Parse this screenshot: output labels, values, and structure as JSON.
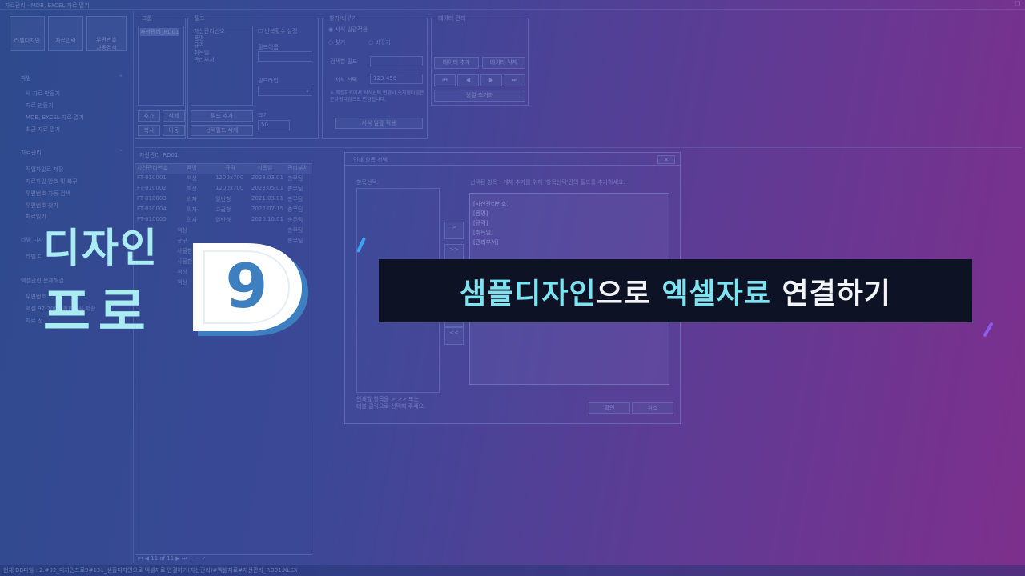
{
  "window": {
    "title": "자료관리 - MDB, EXCEL 자료 열기",
    "toolbar": [
      "라벨디자인",
      "자료입력",
      "우편번호\n자동검색"
    ]
  },
  "sidebar": {
    "sections": [
      {
        "title": "파일",
        "items": [
          "새 자료 만들기",
          "자료 만들기",
          "MDB, EXCEL 자료 열기",
          "최근 자료 열기"
        ]
      },
      {
        "title": "자료관리",
        "items": [
          "작업파일로 저장",
          "자료파일 암호 및 복구",
          "우편번호 자동 검색",
          "우편번호 찾기",
          "자료읽기"
        ]
      },
      {
        "title": "라벨 디자",
        "items": [
          "라벨 디"
        ]
      },
      {
        "title": "엑셀관련 문제해결",
        "items": [
          "우편번호",
          "엑셀 97-2003 통합문서 저장",
          "자료 정"
        ]
      }
    ]
  },
  "group_panel": {
    "label": "그룹",
    "selected": "자산관리_RD01",
    "buttons": [
      "추가",
      "삭제",
      "복사",
      "이동"
    ]
  },
  "field_panel": {
    "label": "필드",
    "fields": [
      "자산관리번호",
      "품명",
      "규격",
      "취득일",
      "관리부서"
    ],
    "repeat_label": "반복횟수 설정",
    "name_label": "필드이름",
    "type_label": "필드타입",
    "size_label": "크기",
    "size_value": "50",
    "buttons": [
      "필드 추가",
      "필드 삭제",
      "선택필드 삭제"
    ]
  },
  "find_panel": {
    "label": "찾기/바꾸기",
    "radio_all": "서식 일괄적용",
    "radio_find": "찾기",
    "radio_replace": "바꾸기",
    "search_field_label": "검색할 필드",
    "format_label": "서식 선택",
    "format_value": "123-456",
    "note": "※ 엑셀자료에서 서식선택 변경시 숫자형타입은 문자형타입으로 변경됩니다.",
    "apply_button": "서식 일괄 적용"
  },
  "data_panel": {
    "label": "데이터 관리",
    "add_button": "데이터 추가",
    "delete_button": "데이터 삭제",
    "nav": [
      "⏮",
      "◀",
      "▶",
      "⏭"
    ],
    "sort_button": "정렬 초기화"
  },
  "grid": {
    "tab": "자산관리_RD01",
    "columns": [
      "자산관리번호",
      "품명",
      "규격",
      "취득일",
      "관리부서"
    ],
    "rows": [
      [
        "FT-010001",
        "책상",
        "1200x700",
        "2023.03.01",
        "총무팀"
      ],
      [
        "FT-010002",
        "책상",
        "1200x700",
        "2023.05.01",
        "총무팀"
      ],
      [
        "FT-010003",
        "의자",
        "일반형",
        "2021.03.01",
        "총무팀"
      ],
      [
        "FT-010004",
        "의자",
        "고급형",
        "2022.07.15",
        "총무팀"
      ],
      [
        "FT-010005",
        "의자",
        "일반형",
        "2020.10.01",
        "총무팀"
      ],
      [
        "",
        "책상",
        "",
        "",
        "총무팀"
      ],
      [
        "",
        "공구",
        "",
        "",
        "총무팀"
      ],
      [
        "",
        "사물함",
        "",
        "",
        ""
      ],
      [
        "",
        "사물함",
        "",
        "",
        ""
      ],
      [
        "",
        "책상",
        "",
        "",
        ""
      ],
      [
        "",
        "책상",
        "",
        "",
        ""
      ]
    ],
    "pager": "11 of 11"
  },
  "dialog": {
    "title": "인쇄 항목 선택",
    "items_label": "항목선택:",
    "selected_label": "선택된 항목 :  개체 추가를 위해 '항목선택'란의 필드를 추가하세요.",
    "selected_items": [
      "[자산관리번호]",
      "[품명]",
      "[규격]",
      "[취득일]",
      "[관리부서]"
    ],
    "hint": "인쇄할 항목을 > >> 또는\n더블 클릭으로 선택해 주세요.",
    "ok_button": "확인",
    "cancel_button": "취소"
  },
  "statusbar": {
    "text": "현재 DB파일 : 2.#02_디자인프로9#131_샘플디자인으로 엑셀자료 연결하기(자산관리)#엑셀자료#자산관리_RD01.XLSX"
  },
  "overlay": {
    "logo_line1": "디자인",
    "logo_line2": "프로",
    "logo_number": "9",
    "banner": {
      "part1": "샘플디자인",
      "part2": "으로 ",
      "part3": "엑셀자료",
      "part4": " 연결하기"
    }
  },
  "colors": {
    "logo_text": "#a9ecf2",
    "banner_highlight": "#7ee3f0",
    "banner_bg": "#0d1324"
  }
}
